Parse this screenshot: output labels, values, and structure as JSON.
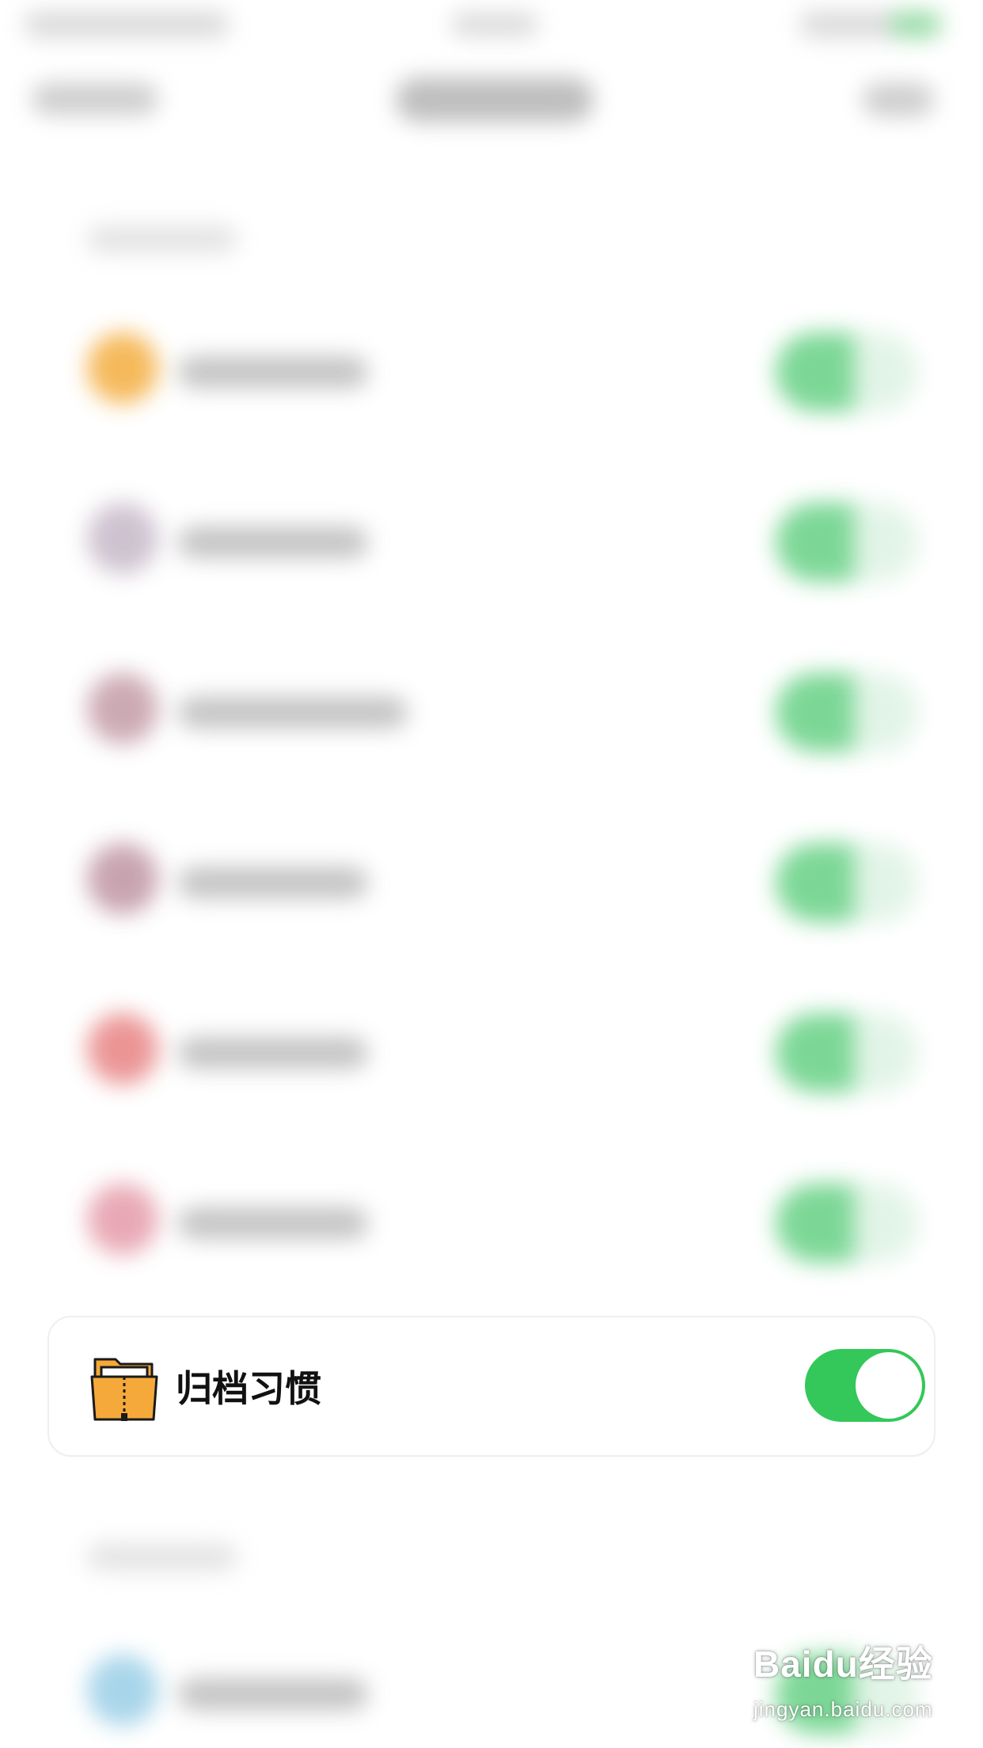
{
  "app": {
    "colors": {
      "toggle_on": "#34c759",
      "card_border": "#f0efeb",
      "icon_orange": "#f6a93b"
    }
  },
  "card": {
    "label": "归档习惯",
    "toggle_on": true,
    "icon_name": "archive-folder-icon"
  },
  "watermark": {
    "brand": "Baidu经验",
    "domain": "jingyan.baidu.com"
  }
}
